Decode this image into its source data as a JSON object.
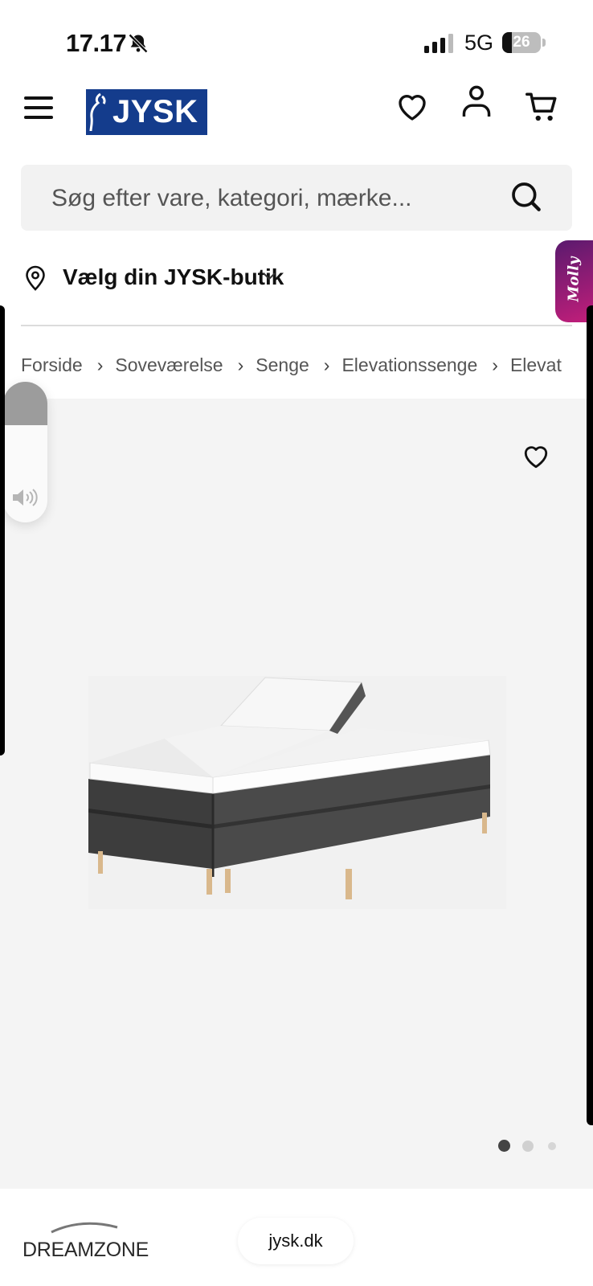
{
  "status_bar": {
    "time": "17.17",
    "network": "5G",
    "battery_level": "26",
    "battery_fraction": 0.26,
    "icons": [
      "bell-muted-icon",
      "signal-icon",
      "battery-icon"
    ]
  },
  "header": {
    "logo_text": "JYSK",
    "icons": [
      "hamburger-menu-icon",
      "heart-icon",
      "user-icon",
      "cart-icon"
    ]
  },
  "search": {
    "placeholder": "Søg efter vare, kategori, mærke..."
  },
  "store_selector": {
    "label": "Vælg din JYSK-butik"
  },
  "chat_tab": {
    "label": "Molly"
  },
  "breadcrumb": {
    "items": [
      "Forside",
      "Soveværelse",
      "Senge",
      "Elevationssenge",
      "Elevat"
    ]
  },
  "gallery": {
    "image": "elevation-bed-image",
    "dots_total": 3,
    "dots_active": 1
  },
  "footer_bar": {
    "brand": "DREAMZONE",
    "url": "jysk.dk"
  },
  "colors": {
    "brand_blue": "#143c8c",
    "gallery_bg": "#f4f4f4",
    "chat_gradient_start": "#5a1a6e",
    "chat_gradient_end": "#c21e7a"
  }
}
